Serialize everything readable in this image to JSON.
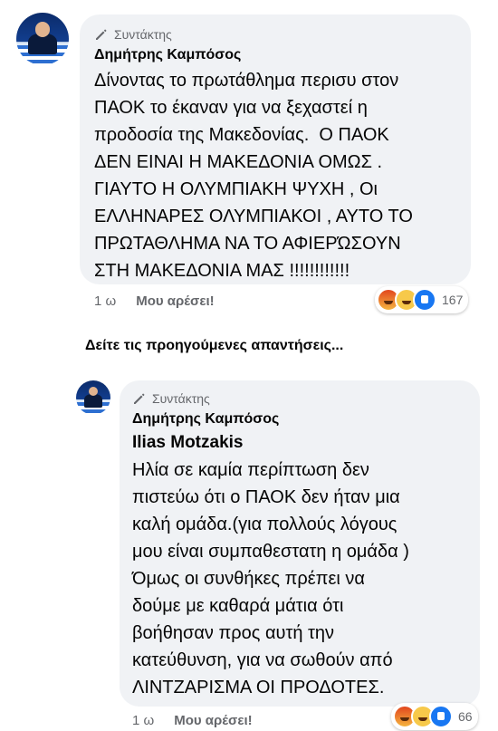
{
  "comment1": {
    "badge": "Συντάκτης",
    "author": "Δημήτρης Καμπόσος",
    "text": "Δίνοντας το πρωτάθλημα περισυ στον\nΠΑΟΚ το έκαναν για να ξεχαστεί η\nπροδοσία της Μακεδονίας.  Ο ΠΑΟΚ\nΔΕΝ ΕΙΝΑΙ Η ΜΑΚΕΔΟΝΙΑ ΟΜΩΣ .\nΓΙΑΥΤΟ Η ΟΛΥΜΠΙΑΚΗ ΨΥΧΗ , Οι\nΕΛΛΗΝΑΡΕΣ ΟΛΥΜΠΙΑΚΟΙ , ΑΥΤΟ ΤΟ\nΠΡΩΤΑΘΛΗΜΑ ΝΑ ΤΟ ΑΦΙΕΡΏΣΟΥΝ\nΣΤΗ ΜΑΚΕΔΟΝΙΑ ΜΑΣ !!!!!!!!!!!!",
    "time": "1 ω",
    "like": "Μου αρέσει!",
    "reaction_icons": [
      "angry-reaction",
      "haha-reaction",
      "like-reaction"
    ],
    "reaction_count": "167"
  },
  "previous_replies": "Δείτε τις προηγούμενες απαντήσεις...",
  "comment2": {
    "badge": "Συντάκτης",
    "author": "Δημήτρης Καμπόσος",
    "mention": "Ilias Motzakis",
    "text": "Ηλία σε καμία περίπτωση δεν\nπιστεύω ότι ο ΠΑΟΚ δεν ήταν μια\nκαλή ομάδα.(για πολλούς λόγους\nμου είναι συμπαθεστατη η ομάδα )\nΌμως οι συνθήκες πρέπει να\nδούμε με καθαρά μάτια ότι\nβοήθησαν προς αυτή την\nκατεύθυνση, για να σωθούν από\nΛΙΝΤΖΑΡΙΣΜΑ ΟΙ ΠΡΟΔΟΤΕΣ.",
    "time": "1 ω",
    "like": "Μου αρέσει!",
    "reaction_icons": [
      "angry-reaction",
      "haha-reaction",
      "like-reaction"
    ],
    "reaction_count": "66"
  }
}
